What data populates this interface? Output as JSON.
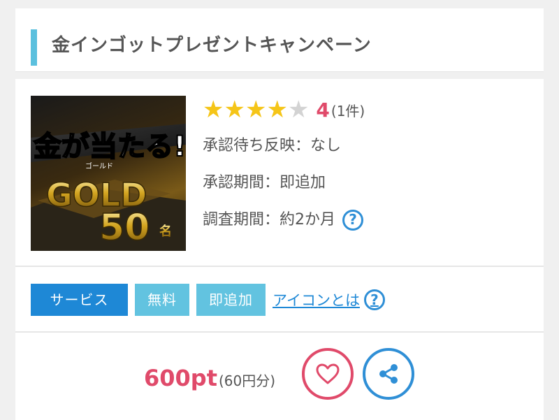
{
  "title": "金インゴットプレゼントキャンペーン",
  "thumbnail": {
    "headline": "金が当たる!",
    "ruby": "ゴールド",
    "gold": "GOLD",
    "count": "50",
    "unit": "名"
  },
  "rating": {
    "stars": 4,
    "max": 5,
    "value": "4",
    "count": "(1件)"
  },
  "info": {
    "pending": "承認待ち反映：なし",
    "approval": "承認期間：即追加",
    "survey": "調査期間：約2か月"
  },
  "tags": {
    "service": "サービス",
    "free": "無料",
    "instant": "即追加"
  },
  "icon_link": "アイコンとは",
  "points": {
    "value": "600pt",
    "yen": "(60円分)"
  },
  "colors": {
    "accent_blue": "#1e88d6",
    "light_blue": "#62c3e0",
    "pink": "#e04a6a",
    "star": "#f5c518"
  },
  "icons": {
    "help": "question-circle-icon",
    "favorite": "heart-icon",
    "share": "share-icon"
  }
}
